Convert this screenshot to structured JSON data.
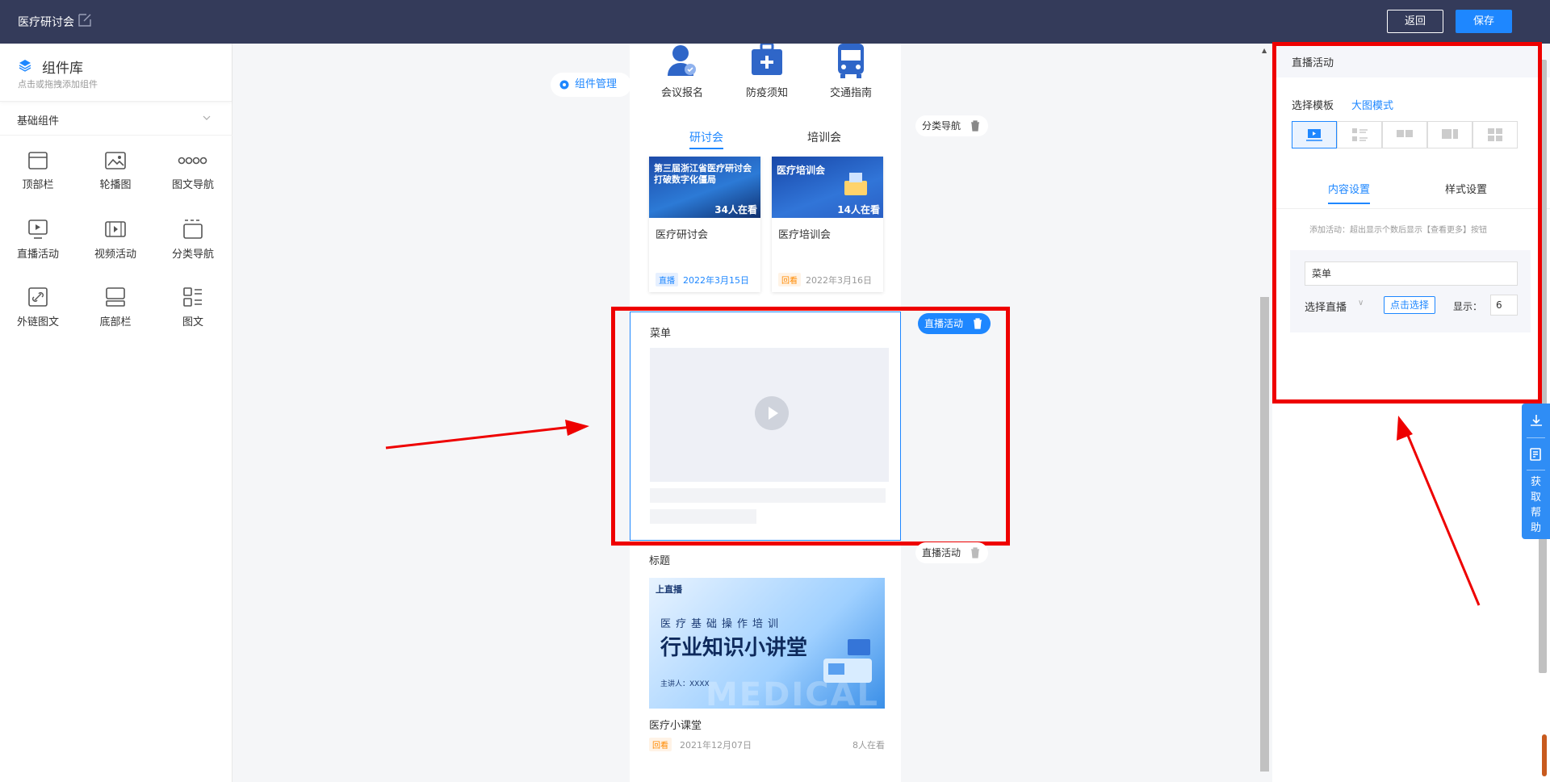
{
  "header": {
    "title": "医疗研讨会",
    "back_label": "返回",
    "save_label": "保存"
  },
  "library": {
    "title": "组件库",
    "subtitle": "点击或拖拽添加组件",
    "group_label": "基础组件",
    "items": [
      {
        "label": "顶部栏",
        "icon": "topbar-icon"
      },
      {
        "label": "轮播图",
        "icon": "carousel-icon"
      },
      {
        "label": "图文导航",
        "icon": "image-nav-icon"
      },
      {
        "label": "直播活动",
        "icon": "live-icon"
      },
      {
        "label": "视频活动",
        "icon": "video-icon"
      },
      {
        "label": "分类导航",
        "icon": "category-nav-icon"
      },
      {
        "label": "外链图文",
        "icon": "link-article-icon"
      },
      {
        "label": "底部栏",
        "icon": "bottombar-icon"
      },
      {
        "label": "图文",
        "icon": "article-icon"
      }
    ]
  },
  "canvas": {
    "manage_label": "组件管理",
    "nav_items": [
      {
        "label": "会议报名",
        "icon": "user-check-icon"
      },
      {
        "label": "防疫须知",
        "icon": "medical-kit-icon"
      },
      {
        "label": "交通指南",
        "icon": "bus-icon"
      }
    ],
    "tabs": [
      "研讨会",
      "培训会"
    ],
    "cards": [
      {
        "thumb_text": "第三届浙江省医疗研讨会 打破数字化僵局",
        "viewers": "34人在看",
        "title": "医疗研讨会",
        "badge": "直播",
        "date": "2022年3月15日"
      },
      {
        "thumb_text": "医疗培训会",
        "viewers": "14人在看",
        "title": "医疗培训会",
        "badge": "回看",
        "date": "2022年3月16日"
      }
    ],
    "selected_block_title": "菜单",
    "side_tags": {
      "category": "分类导航",
      "live_selected": "直播活动",
      "live_lower": "直播活动"
    },
    "lower": {
      "title": "标题",
      "banner_logo": "上直播",
      "banner_sub": "医疗基础操作培训",
      "banner_main": "行业知识小讲堂",
      "banner_speaker": "主讲人：XXXX",
      "banner_watermark": "MEDICAL",
      "name": "医疗小课堂",
      "badge": "回看",
      "date": "2021年12月07日",
      "viewers": "8人在看"
    }
  },
  "panel": {
    "title": "直播活动",
    "template_label": "选择模板",
    "template_mode": "大图模式",
    "tabs": [
      "内容设置",
      "样式设置"
    ],
    "hint": "添加活动：超出显示个数后显示【查看更多】按钮",
    "menu_value": "菜单",
    "select_live_label": "选择直播",
    "click_select_label": "点击选择",
    "show_label": "显示：",
    "show_value": "6"
  },
  "float": {
    "help_text": "获取帮助"
  },
  "colors": {
    "accent": "#1e87ff",
    "header_bg": "#343b5a",
    "highlight": "#e00000"
  }
}
